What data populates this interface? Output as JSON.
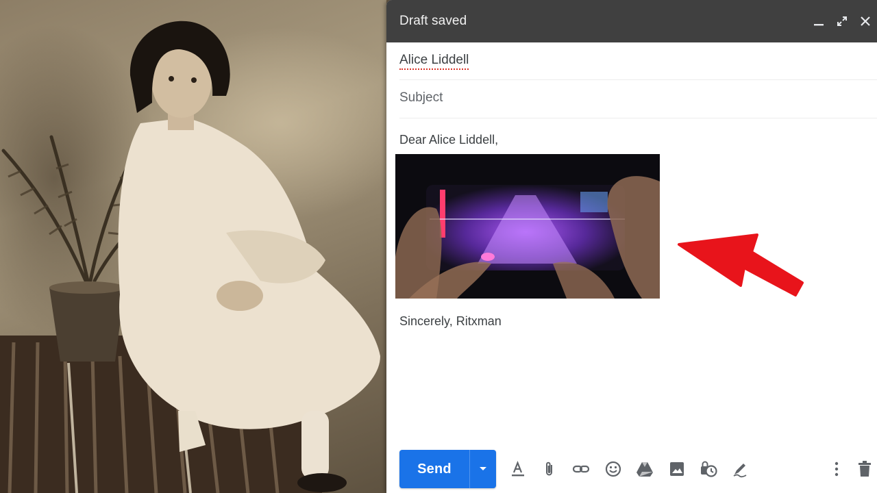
{
  "compose": {
    "status_title": "Draft saved",
    "recipient": "Alice Liddell",
    "subject_placeholder": "Subject",
    "subject_value": "",
    "body": {
      "greeting": "Dear Alice Liddell,",
      "signoff": "Sincerely, Ritxman"
    }
  },
  "toolbar": {
    "send_label": "Send",
    "icons": [
      "format-text-icon",
      "attach-icon",
      "link-icon",
      "emoji-icon",
      "drive-icon",
      "photo-icon",
      "confidential-mode-icon",
      "signature-icon",
      "more-options-icon",
      "discard-icon"
    ]
  },
  "colors": {
    "title_bar": "#404040",
    "send_button": "#1a73e8",
    "annotation_arrow": "#e8141b"
  }
}
